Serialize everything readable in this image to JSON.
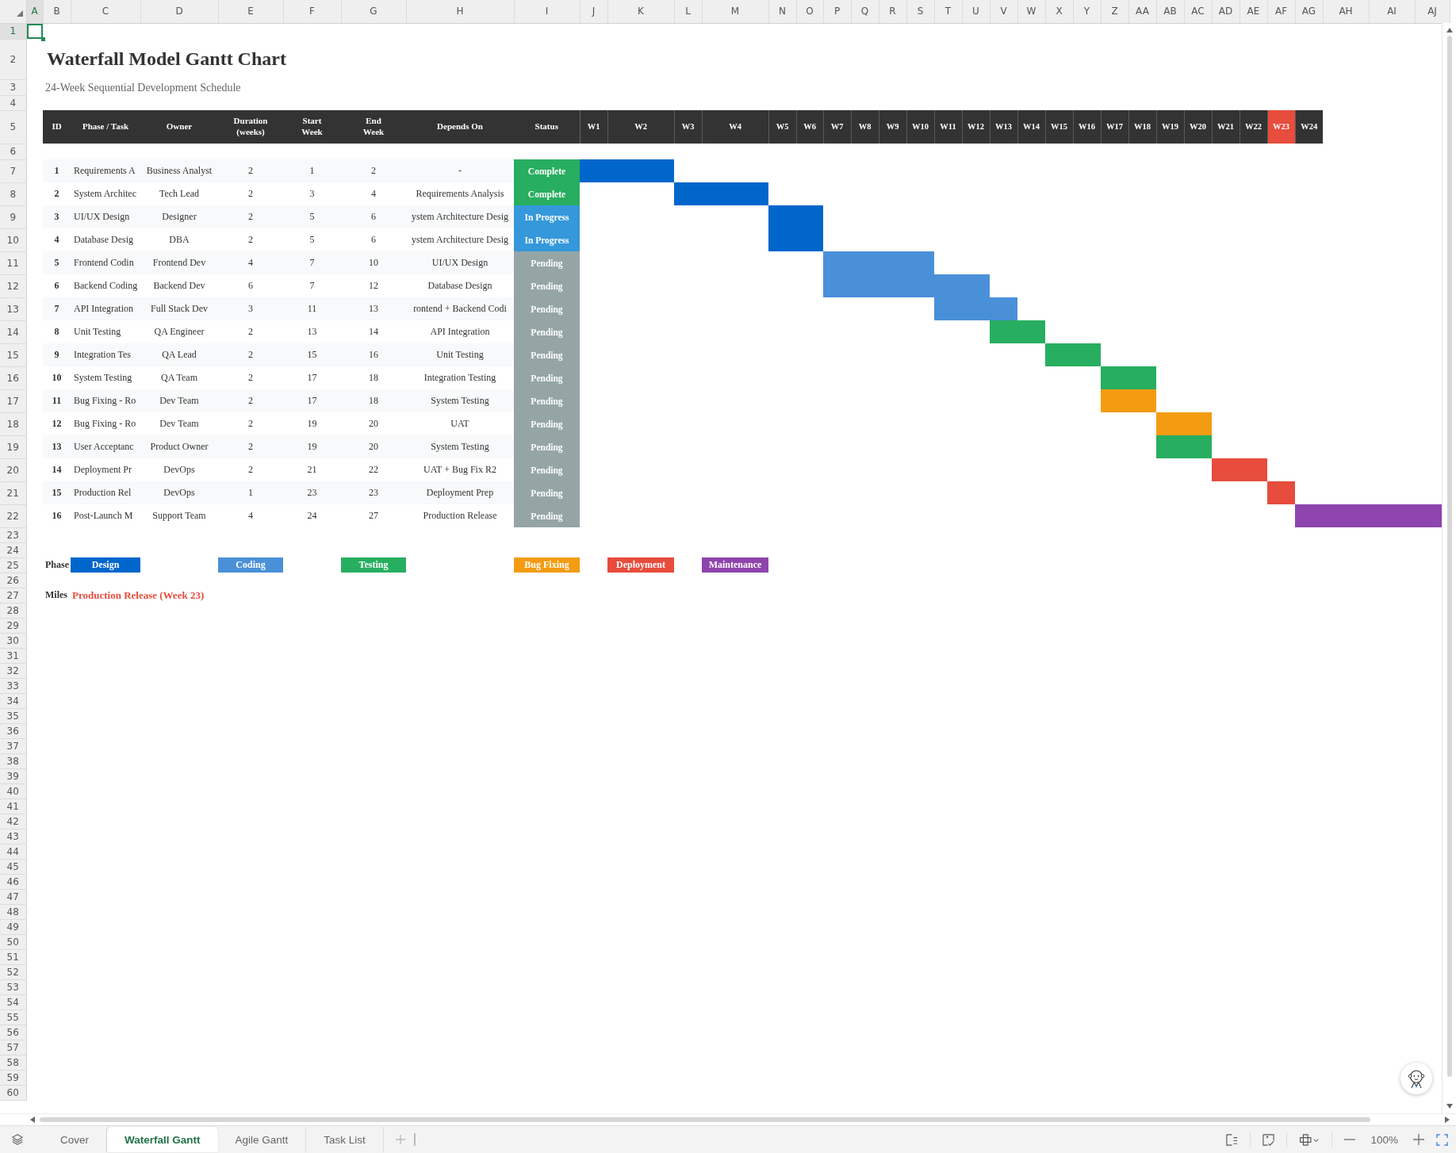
{
  "column_headers": [
    {
      "label": "A",
      "selected": true
    },
    {
      "label": "B",
      "selected": false
    },
    {
      "label": "C",
      "selected": false
    },
    {
      "label": "D",
      "selected": false
    },
    {
      "label": "E",
      "selected": false
    },
    {
      "label": "F",
      "selected": false
    },
    {
      "label": "G",
      "selected": false
    },
    {
      "label": "H",
      "selected": false
    },
    {
      "label": "I",
      "selected": false
    },
    {
      "label": "J",
      "selected": false
    },
    {
      "label": "K",
      "selected": false
    },
    {
      "label": "L",
      "selected": false
    },
    {
      "label": "M",
      "selected": false
    },
    {
      "label": "N",
      "selected": false
    },
    {
      "label": "O",
      "selected": false
    },
    {
      "label": "P",
      "selected": false
    },
    {
      "label": "Q",
      "selected": false
    },
    {
      "label": "R",
      "selected": false
    },
    {
      "label": "S",
      "selected": false
    },
    {
      "label": "T",
      "selected": false
    },
    {
      "label": "U",
      "selected": false
    },
    {
      "label": "V",
      "selected": false
    },
    {
      "label": "W",
      "selected": false
    },
    {
      "label": "X",
      "selected": false
    },
    {
      "label": "Y",
      "selected": false
    },
    {
      "label": "Z",
      "selected": false
    },
    {
      "label": "AA",
      "selected": false
    },
    {
      "label": "AB",
      "selected": false
    },
    {
      "label": "AC",
      "selected": false
    },
    {
      "label": "AD",
      "selected": false
    },
    {
      "label": "AE",
      "selected": false
    },
    {
      "label": "AF",
      "selected": false
    },
    {
      "label": "AG",
      "selected": false
    },
    {
      "label": "AH",
      "selected": false
    },
    {
      "label": "AI",
      "selected": false
    },
    {
      "label": "AJ",
      "selected": false
    }
  ],
  "row_numbers": [
    {
      "label": "1",
      "selected": true
    },
    {
      "label": "2",
      "selected": false
    },
    {
      "label": "3",
      "selected": false
    },
    {
      "label": "4",
      "selected": false
    },
    {
      "label": "5",
      "selected": false
    },
    {
      "label": "6",
      "selected": false
    },
    {
      "label": "7",
      "selected": false
    },
    {
      "label": "8",
      "selected": false
    },
    {
      "label": "9",
      "selected": false
    },
    {
      "label": "10",
      "selected": false
    },
    {
      "label": "11",
      "selected": false
    },
    {
      "label": "12",
      "selected": false
    },
    {
      "label": "13",
      "selected": false
    },
    {
      "label": "14",
      "selected": false
    },
    {
      "label": "15",
      "selected": false
    },
    {
      "label": "16",
      "selected": false
    },
    {
      "label": "17",
      "selected": false
    },
    {
      "label": "18",
      "selected": false
    },
    {
      "label": "19",
      "selected": false
    },
    {
      "label": "20",
      "selected": false
    },
    {
      "label": "21",
      "selected": false
    },
    {
      "label": "22",
      "selected": false
    },
    {
      "label": "23",
      "selected": false
    },
    {
      "label": "24",
      "selected": false
    },
    {
      "label": "25",
      "selected": false
    },
    {
      "label": "26",
      "selected": false
    },
    {
      "label": "27",
      "selected": false
    },
    {
      "label": "28",
      "selected": false
    },
    {
      "label": "29",
      "selected": false
    },
    {
      "label": "30",
      "selected": false
    },
    {
      "label": "31",
      "selected": false
    },
    {
      "label": "32",
      "selected": false
    },
    {
      "label": "33",
      "selected": false
    },
    {
      "label": "34",
      "selected": false
    },
    {
      "label": "35",
      "selected": false
    },
    {
      "label": "36",
      "selected": false
    },
    {
      "label": "37",
      "selected": false
    },
    {
      "label": "38",
      "selected": false
    },
    {
      "label": "39",
      "selected": false
    },
    {
      "label": "40",
      "selected": false
    },
    {
      "label": "41",
      "selected": false
    },
    {
      "label": "42",
      "selected": false
    },
    {
      "label": "43",
      "selected": false
    },
    {
      "label": "44",
      "selected": false
    },
    {
      "label": "45",
      "selected": false
    },
    {
      "label": "46",
      "selected": false
    },
    {
      "label": "47",
      "selected": false
    },
    {
      "label": "48",
      "selected": false
    },
    {
      "label": "49",
      "selected": false
    },
    {
      "label": "50",
      "selected": false
    },
    {
      "label": "51",
      "selected": false
    },
    {
      "label": "52",
      "selected": false
    },
    {
      "label": "53",
      "selected": false
    },
    {
      "label": "54",
      "selected": false
    },
    {
      "label": "55",
      "selected": false
    },
    {
      "label": "56",
      "selected": false
    },
    {
      "label": "57",
      "selected": false
    },
    {
      "label": "58",
      "selected": false
    },
    {
      "label": "59",
      "selected": false
    },
    {
      "label": "60",
      "selected": false
    }
  ],
  "title": "Waterfall Model Gantt Chart",
  "subtitle": "24-Week Sequential Development Schedule",
  "table": {
    "columns": [
      {
        "lines": [
          "ID"
        ]
      },
      {
        "lines": [
          "Phase / Task"
        ]
      },
      {
        "lines": [
          "Owner"
        ]
      },
      {
        "lines": [
          "Duration",
          "(weeks)"
        ]
      },
      {
        "lines": [
          "Start",
          "Week"
        ]
      },
      {
        "lines": [
          "End",
          "Week"
        ]
      },
      {
        "lines": [
          "Depends On"
        ]
      },
      {
        "lines": [
          "Status"
        ]
      }
    ],
    "weeks": [
      {
        "label": "W1",
        "milestone": false
      },
      {
        "label": "W2",
        "milestone": false
      },
      {
        "label": "W3",
        "milestone": false
      },
      {
        "label": "W4",
        "milestone": false
      },
      {
        "label": "W5",
        "milestone": false
      },
      {
        "label": "W6",
        "milestone": false
      },
      {
        "label": "W7",
        "milestone": false
      },
      {
        "label": "W8",
        "milestone": false
      },
      {
        "label": "W9",
        "milestone": false
      },
      {
        "label": "W10",
        "milestone": false
      },
      {
        "label": "W11",
        "milestone": false
      },
      {
        "label": "W12",
        "milestone": false
      },
      {
        "label": "W13",
        "milestone": false
      },
      {
        "label": "W14",
        "milestone": false
      },
      {
        "label": "W15",
        "milestone": false
      },
      {
        "label": "W16",
        "milestone": false
      },
      {
        "label": "W17",
        "milestone": false
      },
      {
        "label": "W18",
        "milestone": false
      },
      {
        "label": "W19",
        "milestone": false
      },
      {
        "label": "W20",
        "milestone": false
      },
      {
        "label": "W21",
        "milestone": false
      },
      {
        "label": "W22",
        "milestone": false
      },
      {
        "label": "W23",
        "milestone": true
      },
      {
        "label": "W24",
        "milestone": false
      }
    ],
    "rows": [
      {
        "id": "1",
        "task": "Requirements A",
        "owner": "Business Analyst",
        "duration": "2",
        "start": "1",
        "end": "2",
        "depends_on": "-",
        "status": {
          "label": "Complete",
          "color": "#27ae60"
        },
        "bar": {
          "color": "#0066cc"
        }
      },
      {
        "id": "2",
        "task": "System Architec",
        "owner": "Tech Lead",
        "duration": "2",
        "start": "3",
        "end": "4",
        "depends_on": "Requirements Analysis",
        "status": {
          "label": "Complete",
          "color": "#27ae60"
        },
        "bar": {
          "color": "#0066cc"
        }
      },
      {
        "id": "3",
        "task": "UI/UX Design",
        "owner": "Designer",
        "duration": "2",
        "start": "5",
        "end": "6",
        "depends_on": "ystem Architecture Desig",
        "status": {
          "label": "In Progress",
          "color": "#3498db"
        },
        "bar": {
          "color": "#0066cc"
        }
      },
      {
        "id": "4",
        "task": "Database Desig",
        "owner": "DBA",
        "duration": "2",
        "start": "5",
        "end": "6",
        "depends_on": "ystem Architecture Desig",
        "status": {
          "label": "In Progress",
          "color": "#3498db"
        },
        "bar": {
          "color": "#0066cc"
        }
      },
      {
        "id": "5",
        "task": "Frontend Codin",
        "owner": "Frontend Dev",
        "duration": "4",
        "start": "7",
        "end": "10",
        "depends_on": "UI/UX Design",
        "status": {
          "label": "Pending",
          "color": "#95a5a6"
        },
        "bar": {
          "color": "#4a90d9"
        }
      },
      {
        "id": "6",
        "task": "Backend Coding",
        "owner": "Backend Dev",
        "duration": "6",
        "start": "7",
        "end": "12",
        "depends_on": "Database Design",
        "status": {
          "label": "Pending",
          "color": "#95a5a6"
        },
        "bar": {
          "color": "#4a90d9"
        }
      },
      {
        "id": "7",
        "task": "API Integration",
        "owner": "Full Stack Dev",
        "duration": "3",
        "start": "11",
        "end": "13",
        "depends_on": "rontend + Backend Codi",
        "status": {
          "label": "Pending",
          "color": "#95a5a6"
        },
        "bar": {
          "color": "#4a90d9"
        }
      },
      {
        "id": "8",
        "task": "Unit Testing",
        "owner": "QA Engineer",
        "duration": "2",
        "start": "13",
        "end": "14",
        "depends_on": "API Integration",
        "status": {
          "label": "Pending",
          "color": "#95a5a6"
        },
        "bar": {
          "color": "#27ae60"
        }
      },
      {
        "id": "9",
        "task": "Integration Tes",
        "owner": "QA Lead",
        "duration": "2",
        "start": "15",
        "end": "16",
        "depends_on": "Unit Testing",
        "status": {
          "label": "Pending",
          "color": "#95a5a6"
        },
        "bar": {
          "color": "#27ae60"
        }
      },
      {
        "id": "10",
        "task": "System Testing",
        "owner": "QA Team",
        "duration": "2",
        "start": "17",
        "end": "18",
        "depends_on": "Integration Testing",
        "status": {
          "label": "Pending",
          "color": "#95a5a6"
        },
        "bar": {
          "color": "#27ae60"
        }
      },
      {
        "id": "11",
        "task": "Bug Fixing - Ro",
        "owner": "Dev Team",
        "duration": "2",
        "start": "17",
        "end": "18",
        "depends_on": "System Testing",
        "status": {
          "label": "Pending",
          "color": "#95a5a6"
        },
        "bar": {
          "color": "#f39c12"
        }
      },
      {
        "id": "12",
        "task": "Bug Fixing - Ro",
        "owner": "Dev Team",
        "duration": "2",
        "start": "19",
        "end": "20",
        "depends_on": "UAT",
        "status": {
          "label": "Pending",
          "color": "#95a5a6"
        },
        "bar": {
          "color": "#f39c12"
        }
      },
      {
        "id": "13",
        "task": "User Acceptanc",
        "owner": "Product Owner",
        "duration": "2",
        "start": "19",
        "end": "20",
        "depends_on": "System Testing",
        "status": {
          "label": "Pending",
          "color": "#95a5a6"
        },
        "bar": {
          "color": "#27ae60"
        }
      },
      {
        "id": "14",
        "task": "Deployment Pr",
        "owner": "DevOps",
        "duration": "2",
        "start": "21",
        "end": "22",
        "depends_on": "UAT + Bug Fix R2",
        "status": {
          "label": "Pending",
          "color": "#95a5a6"
        },
        "bar": {
          "color": "#e74c3c"
        }
      },
      {
        "id": "15",
        "task": "Production Rel",
        "owner": "DevOps",
        "duration": "1",
        "start": "23",
        "end": "23",
        "depends_on": "Deployment Prep",
        "status": {
          "label": "Pending",
          "color": "#95a5a6"
        },
        "bar": {
          "color": "#e74c3c"
        }
      },
      {
        "id": "16",
        "task": "Post-Launch M",
        "owner": "Support Team",
        "duration": "4",
        "start": "24",
        "end": "27",
        "depends_on": "Production Release",
        "status": {
          "label": "Pending",
          "color": "#95a5a6"
        },
        "bar": {
          "color": "#8e44ad"
        }
      }
    ]
  },
  "legend": {
    "label": "Phase",
    "items": [
      {
        "label": "Design",
        "color": "#0066cc"
      },
      {
        "label": "Coding",
        "color": "#4a90d9"
      },
      {
        "label": "Testing",
        "color": "#27ae60"
      },
      {
        "label": "Bug Fixing",
        "color": "#f39c12"
      },
      {
        "label": "Deployment",
        "color": "#e74c3c"
      },
      {
        "label": "Maintenance",
        "color": "#8e44ad"
      }
    ]
  },
  "milestone": {
    "label": "Miles",
    "value": "Production Release (Week 23)"
  },
  "sheet_tabs": [
    {
      "label": "Cover",
      "selected": false
    },
    {
      "label": "Waterfall Gantt",
      "selected": true
    },
    {
      "label": "Agile Gantt",
      "selected": false
    },
    {
      "label": "Task List",
      "selected": false
    }
  ],
  "zoom": "100%"
}
